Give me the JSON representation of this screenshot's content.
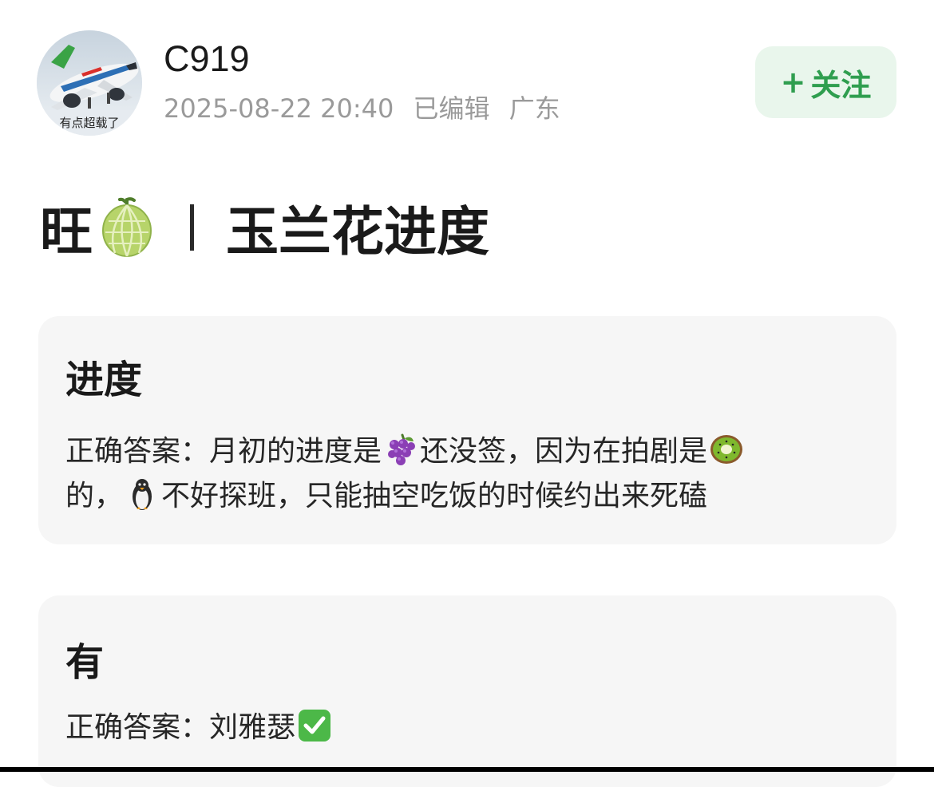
{
  "author": {
    "name": "C919",
    "avatar_caption": "有点超载了",
    "date": "2025-08-22 20:40",
    "edited": "已编辑",
    "location": "广东"
  },
  "follow_button": {
    "plus": "+",
    "label": "关注"
  },
  "post": {
    "title_prefix": "旺",
    "title_icon": "melon-emoji",
    "title_text": "玉兰花进度"
  },
  "cards": [
    {
      "heading": "进度",
      "body": {
        "part1": "正确答案：月初的进度是",
        "icon1": "grapes-emoji",
        "part2": "还没签，因为在拍剧是",
        "icon2": "kiwi-emoji",
        "part3": "的，",
        "icon3": "penguin-emoji",
        "part4": "不好探班，只能抽空吃饭的时候约出来死磕"
      }
    },
    {
      "heading": "有",
      "body": {
        "part1": "正确答案：刘雅瑟",
        "icon1": "check-mark-button-emoji"
      }
    }
  ],
  "colors": {
    "follow_text": "#2f9e4f",
    "follow_bg": "#e9f6ec",
    "card_bg": "#f6f6f6",
    "meta_text": "#9a9a9a"
  }
}
